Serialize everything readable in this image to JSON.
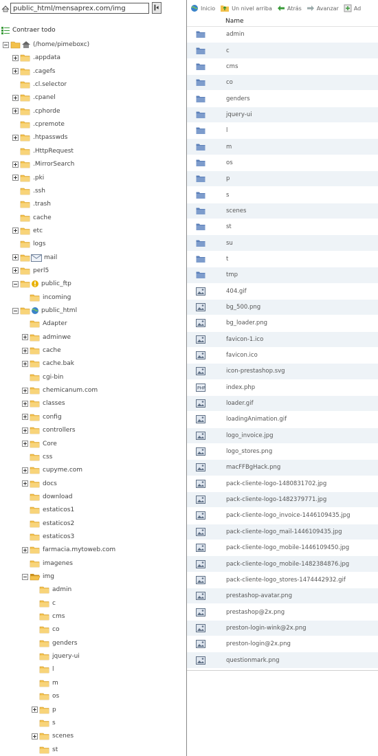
{
  "path": {
    "value": "public_html/mensaprex.com/img"
  },
  "tree_collapse_label": "Contraer todo",
  "tree": [
    {
      "label": "(/home/pimeboxc)",
      "icon": "home-icon",
      "level": 0,
      "expander": "minus"
    },
    {
      "label": ".appdata",
      "icon": "folder-icon",
      "level": 1,
      "expander": "plus"
    },
    {
      "label": ".cagefs",
      "icon": "folder-icon",
      "level": 1,
      "expander": "plus"
    },
    {
      "label": ".cl.selector",
      "icon": "folder-icon",
      "level": 1,
      "expander": "none"
    },
    {
      "label": ".cpanel",
      "icon": "folder-icon",
      "level": 1,
      "expander": "plus"
    },
    {
      "label": ".cphorde",
      "icon": "folder-icon",
      "level": 1,
      "expander": "plus"
    },
    {
      "label": ".cpremote",
      "icon": "folder-icon",
      "level": 1,
      "expander": "none"
    },
    {
      "label": ".htpasswds",
      "icon": "folder-icon",
      "level": 1,
      "expander": "plus"
    },
    {
      "label": ".HttpRequest",
      "icon": "folder-icon",
      "level": 1,
      "expander": "none"
    },
    {
      "label": ".MirrorSearch",
      "icon": "folder-icon",
      "level": 1,
      "expander": "plus"
    },
    {
      "label": ".pki",
      "icon": "folder-icon",
      "level": 1,
      "expander": "plus"
    },
    {
      "label": ".ssh",
      "icon": "folder-icon",
      "level": 1,
      "expander": "none"
    },
    {
      "label": ".trash",
      "icon": "folder-icon",
      "level": 1,
      "expander": "none"
    },
    {
      "label": "cache",
      "icon": "folder-icon",
      "level": 1,
      "expander": "none"
    },
    {
      "label": "etc",
      "icon": "folder-icon",
      "level": 1,
      "expander": "plus"
    },
    {
      "label": "logs",
      "icon": "folder-icon",
      "level": 1,
      "expander": "none"
    },
    {
      "label": "mail",
      "icon": "mail-folder-icon",
      "level": 1,
      "expander": "plus"
    },
    {
      "label": "perl5",
      "icon": "folder-icon",
      "level": 1,
      "expander": "plus"
    },
    {
      "label": "public_ftp",
      "icon": "ftp-folder-icon",
      "level": 1,
      "expander": "minus"
    },
    {
      "label": "incoming",
      "icon": "folder-icon",
      "level": 2,
      "expander": "none"
    },
    {
      "label": "public_html",
      "icon": "web-folder-icon",
      "level": 1,
      "expander": "minus"
    },
    {
      "label": "Adapter",
      "icon": "folder-icon",
      "level": 2,
      "expander": "none"
    },
    {
      "label": "adminwe",
      "icon": "folder-icon",
      "level": 2,
      "expander": "plus"
    },
    {
      "label": "cache",
      "icon": "folder-icon",
      "level": 2,
      "expander": "plus"
    },
    {
      "label": "cache.bak",
      "icon": "folder-icon",
      "level": 2,
      "expander": "plus"
    },
    {
      "label": "cgi-bin",
      "icon": "folder-icon",
      "level": 2,
      "expander": "none"
    },
    {
      "label": "chemicanum.com",
      "icon": "folder-icon",
      "level": 2,
      "expander": "plus"
    },
    {
      "label": "classes",
      "icon": "folder-icon",
      "level": 2,
      "expander": "plus"
    },
    {
      "label": "config",
      "icon": "folder-icon",
      "level": 2,
      "expander": "plus"
    },
    {
      "label": "controllers",
      "icon": "folder-icon",
      "level": 2,
      "expander": "plus"
    },
    {
      "label": "Core",
      "icon": "folder-icon",
      "level": 2,
      "expander": "plus"
    },
    {
      "label": "css",
      "icon": "folder-icon",
      "level": 2,
      "expander": "none"
    },
    {
      "label": "cupyme.com",
      "icon": "folder-icon",
      "level": 2,
      "expander": "plus"
    },
    {
      "label": "docs",
      "icon": "folder-icon",
      "level": 2,
      "expander": "plus"
    },
    {
      "label": "download",
      "icon": "folder-icon",
      "level": 2,
      "expander": "none"
    },
    {
      "label": "estaticos1",
      "icon": "folder-icon",
      "level": 2,
      "expander": "none"
    },
    {
      "label": "estaticos2",
      "icon": "folder-icon",
      "level": 2,
      "expander": "none"
    },
    {
      "label": "estaticos3",
      "icon": "folder-icon",
      "level": 2,
      "expander": "none"
    },
    {
      "label": "farmacia.mytoweb.com",
      "icon": "folder-icon",
      "level": 2,
      "expander": "plus"
    },
    {
      "label": "imagenes",
      "icon": "folder-icon",
      "level": 2,
      "expander": "none"
    },
    {
      "label": "img",
      "icon": "open-folder-icon",
      "level": 2,
      "expander": "minus"
    },
    {
      "label": "admin",
      "icon": "folder-icon",
      "level": 3,
      "expander": "none"
    },
    {
      "label": "c",
      "icon": "folder-icon",
      "level": 3,
      "expander": "none"
    },
    {
      "label": "cms",
      "icon": "folder-icon",
      "level": 3,
      "expander": "none"
    },
    {
      "label": "co",
      "icon": "folder-icon",
      "level": 3,
      "expander": "none"
    },
    {
      "label": "genders",
      "icon": "folder-icon",
      "level": 3,
      "expander": "none"
    },
    {
      "label": "jquery-ui",
      "icon": "folder-icon",
      "level": 3,
      "expander": "none"
    },
    {
      "label": "l",
      "icon": "folder-icon",
      "level": 3,
      "expander": "none"
    },
    {
      "label": "m",
      "icon": "folder-icon",
      "level": 3,
      "expander": "none"
    },
    {
      "label": "os",
      "icon": "folder-icon",
      "level": 3,
      "expander": "none"
    },
    {
      "label": "p",
      "icon": "folder-icon",
      "level": 3,
      "expander": "plus"
    },
    {
      "label": "s",
      "icon": "folder-icon",
      "level": 3,
      "expander": "none"
    },
    {
      "label": "scenes",
      "icon": "folder-icon",
      "level": 3,
      "expander": "plus"
    },
    {
      "label": "st",
      "icon": "folder-icon",
      "level": 3,
      "expander": "none"
    }
  ],
  "toolbar": [
    {
      "label": "Inicio",
      "icon": "home-globe-icon"
    },
    {
      "label": "Un nivel arriba",
      "icon": "up-level-icon"
    },
    {
      "label": "Atrás",
      "icon": "back-arrow-icon"
    },
    {
      "label": "Avanzar",
      "icon": "forward-arrow-icon"
    },
    {
      "label": "Ad",
      "icon": "add-icon"
    }
  ],
  "list_header": {
    "name": "Name"
  },
  "files": [
    {
      "name": "admin",
      "type": "folder-icon"
    },
    {
      "name": "c",
      "type": "folder-icon"
    },
    {
      "name": "cms",
      "type": "folder-icon"
    },
    {
      "name": "co",
      "type": "folder-icon"
    },
    {
      "name": "genders",
      "type": "folder-icon"
    },
    {
      "name": "jquery-ui",
      "type": "folder-icon"
    },
    {
      "name": "l",
      "type": "folder-icon"
    },
    {
      "name": "m",
      "type": "folder-icon"
    },
    {
      "name": "os",
      "type": "folder-icon"
    },
    {
      "name": "p",
      "type": "folder-icon"
    },
    {
      "name": "s",
      "type": "folder-icon"
    },
    {
      "name": "scenes",
      "type": "folder-icon"
    },
    {
      "name": "st",
      "type": "folder-icon"
    },
    {
      "name": "su",
      "type": "folder-icon"
    },
    {
      "name": "t",
      "type": "folder-icon"
    },
    {
      "name": "tmp",
      "type": "folder-icon"
    },
    {
      "name": "404.gif",
      "type": "image-file-icon"
    },
    {
      "name": "bg_500.png",
      "type": "image-file-icon"
    },
    {
      "name": "bg_loader.png",
      "type": "image-file-icon"
    },
    {
      "name": "favicon-1.ico",
      "type": "image-file-icon"
    },
    {
      "name": "favicon.ico",
      "type": "image-file-icon"
    },
    {
      "name": "icon-prestashop.svg",
      "type": "image-file-icon"
    },
    {
      "name": "index.php",
      "type": "php-file-icon"
    },
    {
      "name": "loader.gif",
      "type": "image-file-icon"
    },
    {
      "name": "loadingAnimation.gif",
      "type": "image-file-icon"
    },
    {
      "name": "logo_invoice.jpg",
      "type": "image-file-icon"
    },
    {
      "name": "logo_stores.png",
      "type": "image-file-icon"
    },
    {
      "name": "macFFBgHack.png",
      "type": "image-file-icon"
    },
    {
      "name": "pack-cliente-logo-1480831702.jpg",
      "type": "image-file-icon"
    },
    {
      "name": "pack-cliente-logo-1482379771.jpg",
      "type": "image-file-icon"
    },
    {
      "name": "pack-cliente-logo_invoice-1446109435.jpg",
      "type": "image-file-icon"
    },
    {
      "name": "pack-cliente-logo_mail-1446109435.jpg",
      "type": "image-file-icon"
    },
    {
      "name": "pack-cliente-logo_mobile-1446109450.jpg",
      "type": "image-file-icon"
    },
    {
      "name": "pack-cliente-logo_mobile-1482384876.jpg",
      "type": "image-file-icon"
    },
    {
      "name": "pack-cliente-logo_stores-1474442932.gif",
      "type": "image-file-icon"
    },
    {
      "name": "prestashop-avatar.png",
      "type": "image-file-icon"
    },
    {
      "name": "prestashop@2x.png",
      "type": "image-file-icon"
    },
    {
      "name": "preston-login-wink@2x.png",
      "type": "image-file-icon"
    },
    {
      "name": "preston-login@2x.png",
      "type": "image-file-icon"
    },
    {
      "name": "questionmark.png",
      "type": "image-file-icon"
    }
  ],
  "colors": {
    "folder": "#f3c14b",
    "folder_dark": "#c98f1c",
    "blue_folder": "#5b7fb8",
    "row_alt": "#eef3f7"
  }
}
